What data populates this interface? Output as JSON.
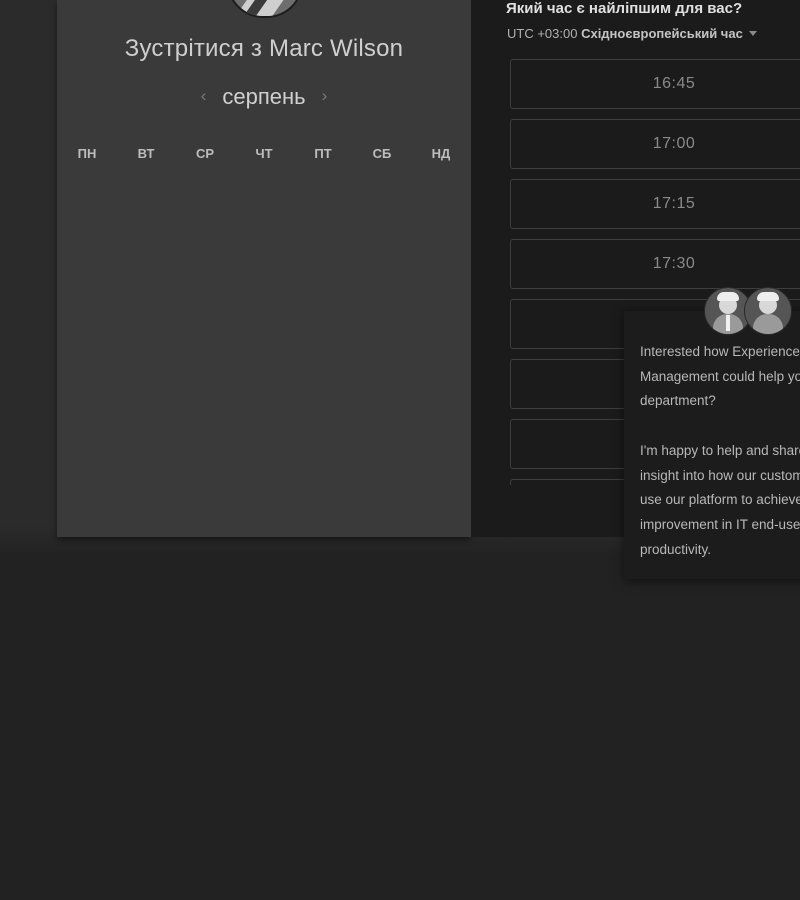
{
  "scheduler": {
    "title": "Зустрітися з Marc Wilson",
    "month": "серпень",
    "prev_icon": "‹",
    "next_icon": "›",
    "weekdays": [
      "ПН",
      "ВТ",
      "СР",
      "ЧТ",
      "ПТ",
      "СБ",
      "НД"
    ]
  },
  "time_picker": {
    "question": "Який час є найліпшим для вас?",
    "timezone_offset": "UTC +03:00",
    "timezone_name": "Східноєвропейський час",
    "slots": [
      "16:45",
      "17:00",
      "17:15",
      "17:30",
      "",
      "",
      ""
    ]
  },
  "chat": {
    "message_1": "Interested how Experience\nManagement could help your\ndepartment?",
    "message_2": "I'm happy to help and share\ninsight into how our customers\nuse our platform to achieve\nimprovement in IT end-user\nproductivity."
  },
  "colors": {
    "background": "#222222",
    "calendar_panel": "#3a3a3a",
    "time_panel": "#1b1b1b",
    "slot_border": "#3e3e3e"
  }
}
